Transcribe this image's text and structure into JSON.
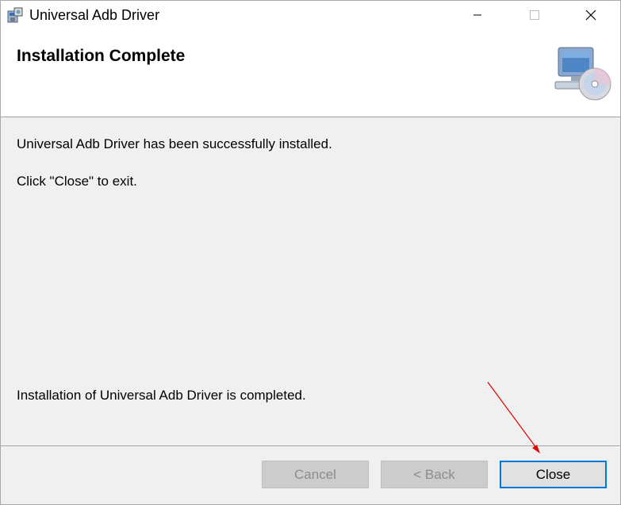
{
  "window": {
    "title": "Universal Adb Driver"
  },
  "title_controls": {
    "minimize": "—",
    "maximize": "☐",
    "close": "✕"
  },
  "header": {
    "title": "Installation Complete",
    "art_icon": "computer-cd-icon"
  },
  "content": {
    "message1": "Universal Adb Driver has been successfully installed.",
    "message2": "Click \"Close\" to exit.",
    "message3": "Installation of Universal Adb Driver is completed."
  },
  "buttons": {
    "cancel": "Cancel",
    "back": "< Back",
    "close": "Close"
  },
  "colors": {
    "annotation_arrow": "#e00000",
    "focus_border": "#0078d7"
  }
}
